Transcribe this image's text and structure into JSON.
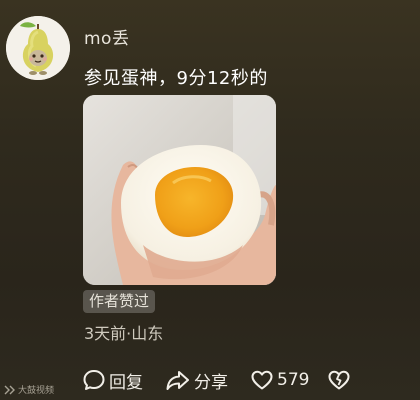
{
  "comment": {
    "username": "mo丢",
    "text": "参见蛋神，9分12秒的",
    "author_badge": "作者赞过",
    "meta": "3天前·山东"
  },
  "actions": {
    "reply_label": "回复",
    "share_label": "分享",
    "like_count": "579"
  },
  "watermark": {
    "text": "大鼓视频"
  },
  "icons": {
    "avatar": "pear-character-avatar",
    "reply": "reply-bubble-icon",
    "share": "share-arrow-icon",
    "like": "heart-icon",
    "dislike": "broken-heart-icon"
  },
  "colors": {
    "background": "#2f2a1d",
    "egg_yolk": "#f2a51c",
    "egg_white": "#fbf7ee"
  }
}
